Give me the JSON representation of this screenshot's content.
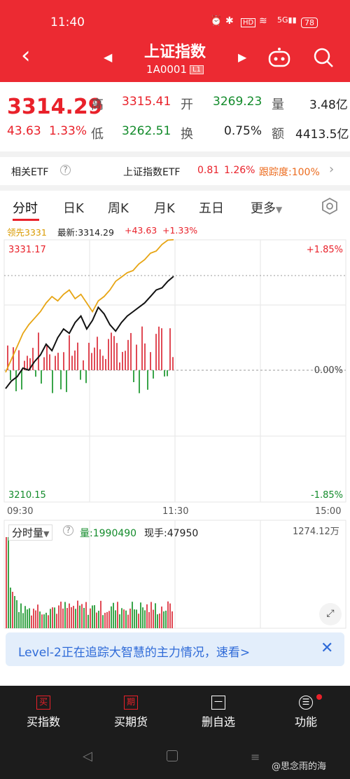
{
  "status": {
    "time": "11:40",
    "battery": "78"
  },
  "header": {
    "title": "上证指数",
    "code": "1A0001",
    "tag": "L1"
  },
  "quote": {
    "price": "3314.29",
    "change": "43.63",
    "change_pct": "1.33%",
    "high_label": "高",
    "high": "3315.41",
    "open_label": "开",
    "open": "3269.23",
    "vol_label": "量",
    "vol": "3.48亿",
    "low_label": "低",
    "low": "3262.51",
    "turn_label": "换",
    "turn": "0.75%",
    "amt_label": "额",
    "amt": "4413.5亿"
  },
  "etf": {
    "label": "相关ETF",
    "name": "上证指数ETF",
    "price": "0.81",
    "pct": "1.26%",
    "track": "跟踪度:100%"
  },
  "tabs": [
    "分时",
    "日K",
    "周K",
    "月K",
    "五日",
    "更多"
  ],
  "info": {
    "lead": "领先3331",
    "latest": "最新:3314.29",
    "chg": "+43.63",
    "pct": "+1.33%"
  },
  "axis": {
    "top": "3331.17",
    "bottom": "3210.15",
    "top_pct": "+1.85%",
    "mid_pct": "0.00%",
    "bottom_pct": "-1.85%",
    "t1": "09:30",
    "t2": "11:30",
    "t3": "15:00"
  },
  "volume": {
    "label": "分时量",
    "vol": "量:1990490",
    "hand": "现手:47950",
    "max": "1274.12万"
  },
  "banner": {
    "text": "Level-2正在追踪大智慧的主力情况，速看>"
  },
  "nav": [
    {
      "icon": "买",
      "label": "买指数"
    },
    {
      "icon": "期",
      "label": "买期货"
    },
    {
      "icon": "一",
      "label": "删自选"
    },
    {
      "icon": "☰",
      "label": "功能"
    }
  ],
  "watermark": "@思念雨的海",
  "chart_data": {
    "type": "line",
    "ylim": [
      3210.15,
      3331.17
    ],
    "baseline": 3270.66,
    "series": [
      {
        "values": [
          3262.5,
          3266,
          3268,
          3272,
          3271,
          3275,
          3278,
          3283,
          3280,
          3286,
          3290,
          3288,
          3293,
          3296,
          3290,
          3294,
          3300,
          3297,
          3292,
          3289,
          3293,
          3296,
          3298,
          3300,
          3302,
          3305,
          3308,
          3309,
          3312,
          3314.3
        ]
      },
      {
        "values": [
          3270,
          3276,
          3282,
          3288,
          3292,
          3295,
          3298,
          3302,
          3305,
          3303,
          3306,
          3308,
          3304,
          3306,
          3302,
          3298,
          3303,
          3305,
          3308,
          3312,
          3314,
          3316,
          3317,
          3320,
          3322,
          3325,
          3326,
          3329,
          3331,
          3331.2
        ]
      }
    ]
  }
}
